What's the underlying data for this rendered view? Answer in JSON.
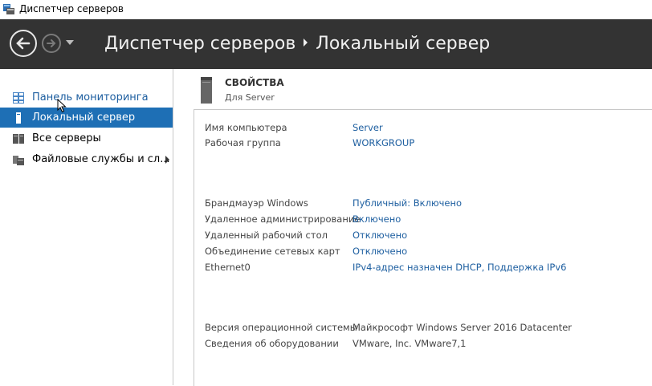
{
  "window": {
    "title": "Диспетчер серверов"
  },
  "header": {
    "breadcrumb": [
      "Диспетчер серверов",
      "Локальный сервер"
    ]
  },
  "sidebar": {
    "items": [
      {
        "label": "Панель мониторинга",
        "icon": "dashboard-icon"
      },
      {
        "label": "Локальный сервер",
        "icon": "server-icon"
      },
      {
        "label": "Все серверы",
        "icon": "servers-icon"
      },
      {
        "label": "Файловые службы и сл...",
        "icon": "file-services-icon"
      }
    ]
  },
  "properties": {
    "title": "СВОЙСТВА",
    "subtitle": "Для Server",
    "rows": [
      {
        "key": "Имя компьютера",
        "value": "Server"
      },
      {
        "key": "Рабочая группа",
        "value": "WORKGROUP"
      },
      {
        "key": "Брандмауэр Windows",
        "value": "Публичный: Включено"
      },
      {
        "key": "Удаленное администрирование",
        "value": "Включено"
      },
      {
        "key": "Удаленный рабочий стол",
        "value": "Отключено"
      },
      {
        "key": "Объединение сетевых карт",
        "value": "Отключено"
      },
      {
        "key": "Ethernet0",
        "value": "IPv4-адрес назначен DHCP, Поддержка IPv6"
      },
      {
        "key": "Версия операционной системы",
        "value": "Майкрософт Windows Server 2016 Datacenter"
      },
      {
        "key": "Сведения об оборудовании",
        "value": "VMware, Inc. VMware7,1"
      }
    ]
  },
  "colors": {
    "header_bg": "#333333",
    "accent": "#1e6fb5",
    "link": "#1e5fa0"
  }
}
